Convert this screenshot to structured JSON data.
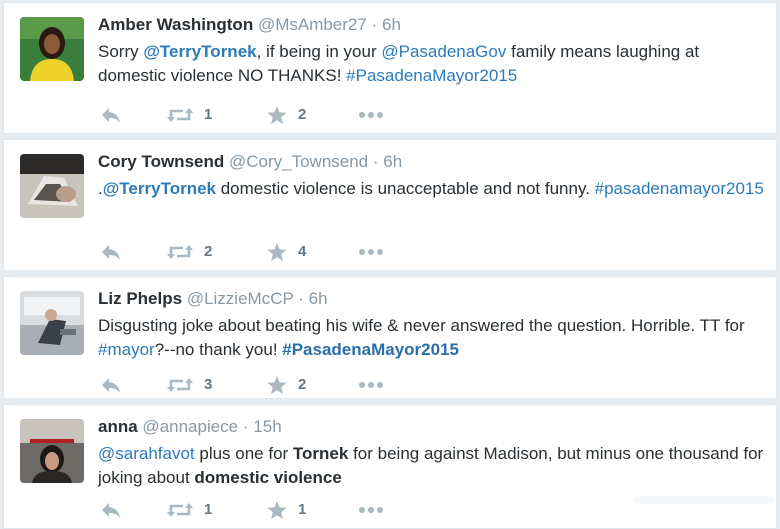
{
  "tweets": [
    {
      "name": "Amber Washington",
      "handle": "@MsAmber27",
      "separator": "·",
      "time": "6h",
      "body": [
        {
          "text": "Sorry ",
          "style": "plain"
        },
        {
          "text": "@TerryTornek",
          "style": "mention"
        },
        {
          "text": ", if being in your ",
          "style": "plain"
        },
        {
          "text": "@PasadenaGov",
          "style": "link"
        },
        {
          "text": " family means laughing at domestic violence NO THANKS! ",
          "style": "plain"
        },
        {
          "text": "#PasadenaMayor2015",
          "style": "link"
        }
      ],
      "retweets": "1",
      "favorites": "2",
      "avatar": "avatar-amber"
    },
    {
      "name": "Cory Townsend",
      "handle": "@Cory_Townsend",
      "separator": "·",
      "time": "6h",
      "body": [
        {
          "text": ".",
          "style": "plain"
        },
        {
          "text": "@TerryTornek",
          "style": "mention"
        },
        {
          "text": " domestic violence is unacceptable and not funny. ",
          "style": "plain"
        },
        {
          "text": "#pasadenamayor2015",
          "style": "link"
        }
      ],
      "retweets": "2",
      "favorites": "4",
      "avatar": "avatar-cory"
    },
    {
      "name": "Liz Phelps",
      "handle": "@LizzieMcCP",
      "separator": "·",
      "time": "6h",
      "body": [
        {
          "text": "Disgusting joke about beating his wife & never answered the question. Horrible. TT for ",
          "style": "plain"
        },
        {
          "text": "#mayor",
          "style": "link"
        },
        {
          "text": "?--no thank you!   ",
          "style": "plain"
        },
        {
          "text": "#PasadenaMayor2015",
          "style": "hl"
        }
      ],
      "retweets": "3",
      "favorites": "2",
      "avatar": "avatar-liz"
    },
    {
      "name": "anna",
      "handle": "@annapiece",
      "separator": "·",
      "time": "15h",
      "body": [
        {
          "text": "@sarahfavot",
          "style": "link"
        },
        {
          "text": " plus one for ",
          "style": "plain"
        },
        {
          "text": "Tornek",
          "style": "bold"
        },
        {
          "text": " for being against Madison, but minus one thousand for joking about ",
          "style": "plain"
        },
        {
          "text": "domestic violence",
          "style": "bold"
        }
      ],
      "retweets": "1",
      "favorites": "1",
      "avatar": "avatar-anna"
    }
  ],
  "icons": {
    "reply": "reply-icon",
    "retweet": "retweet-icon",
    "favorite": "star-icon",
    "more": "more-icon"
  },
  "colors": {
    "link": "#2b7bb9",
    "mention": "#2b6fa8",
    "meta": "#8899a6",
    "icon": "#aab8c2",
    "background": "#e6ecf0"
  }
}
